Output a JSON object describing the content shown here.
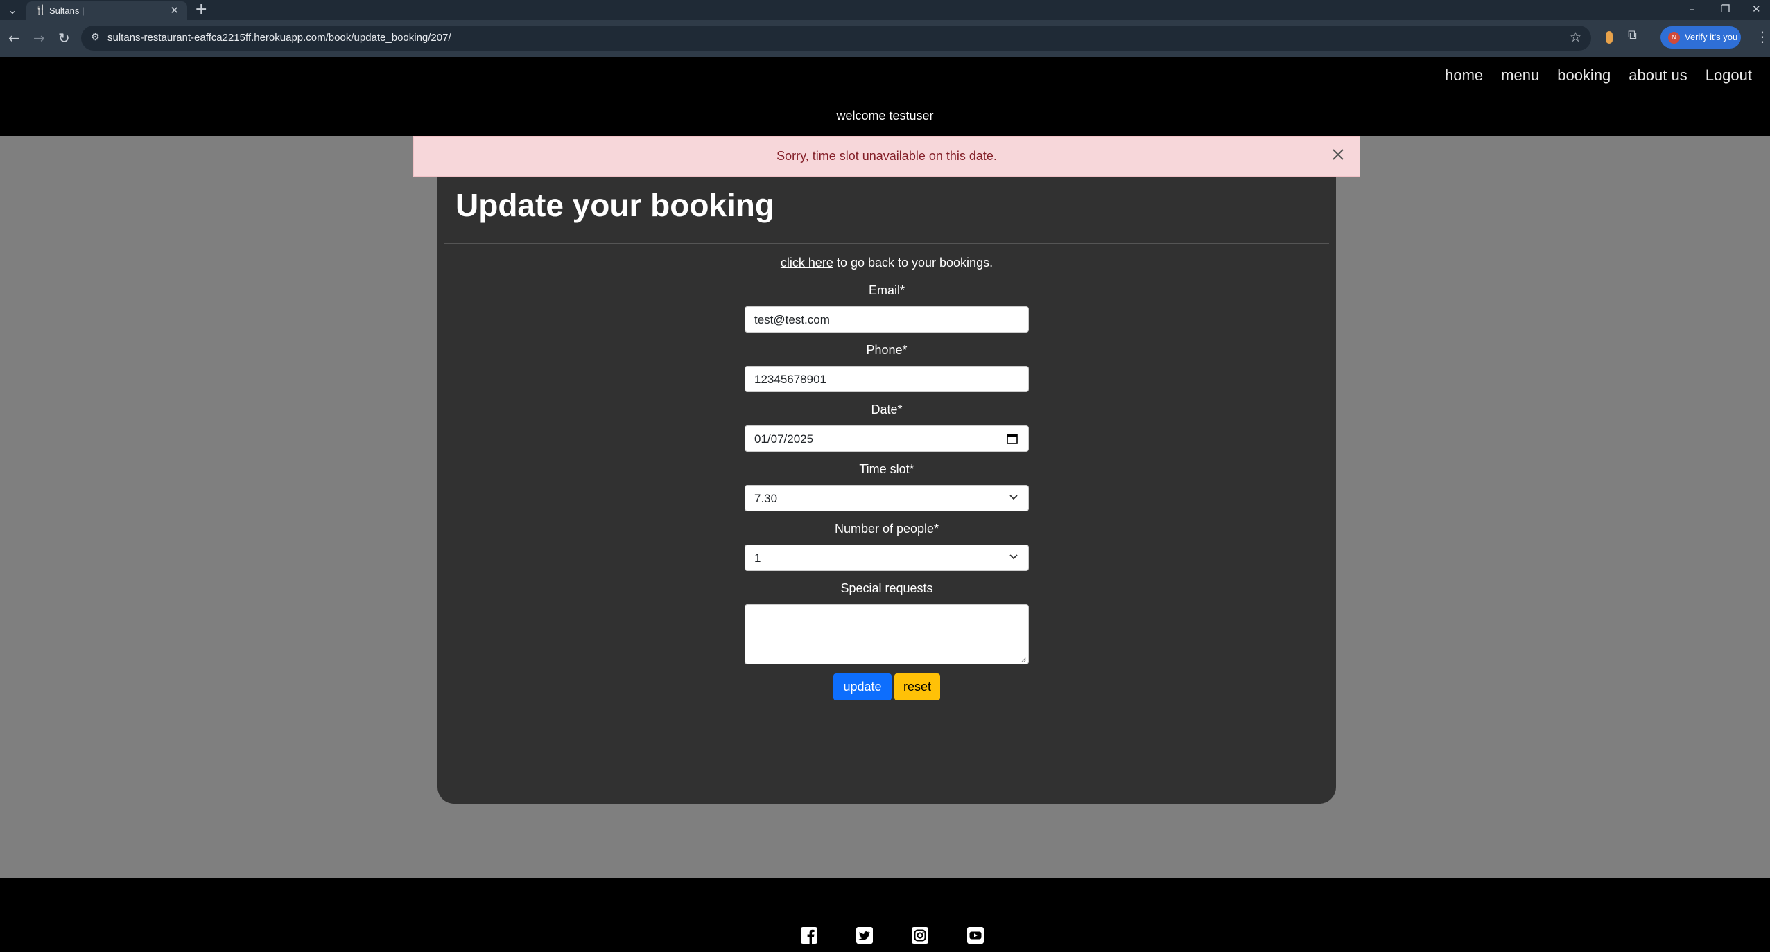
{
  "browser": {
    "tab_title": "Sultans |",
    "url": "sultans-restaurant-eaffca2215ff.herokuapp.com/book/update_booking/207/",
    "profile_initial": "N",
    "verify_label": "Verify it's you"
  },
  "nav": {
    "links": [
      "home",
      "menu",
      "booking",
      "about us",
      "Logout"
    ]
  },
  "header": {
    "welcome": "welcome testuser"
  },
  "alert": {
    "message": "Sorry, time slot unavailable on this date."
  },
  "form": {
    "title": "Update your booking",
    "back_link": "click here",
    "back_text": " to go back to your bookings.",
    "email_label": "Email*",
    "email_value": "test@test.com",
    "phone_label": "Phone*",
    "phone_value": "12345678901",
    "date_label": "Date*",
    "date_value": "01/07/2025",
    "timeslot_label": "Time slot*",
    "timeslot_value": "7.30",
    "people_label": "Number of people*",
    "people_value": "1",
    "requests_label": "Special requests",
    "requests_value": "",
    "update_label": "update",
    "reset_label": "reset"
  },
  "footer": {
    "social": [
      "facebook-icon",
      "twitter-icon",
      "instagram-icon",
      "youtube-icon"
    ]
  },
  "colors": {
    "page_bg": "#7f7f7f",
    "card_bg": "#313131",
    "alert_bg": "#f7d7da",
    "alert_text": "#842029",
    "update_btn": "#0d6efd",
    "reset_btn": "#ffc107"
  }
}
